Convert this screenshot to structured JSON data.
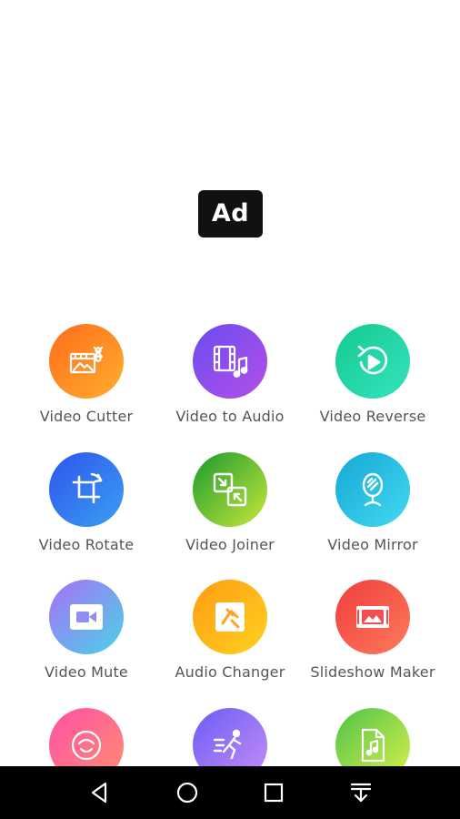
{
  "ad": {
    "badge_label": "Ad"
  },
  "tools": [
    {
      "label": "Video Cutter",
      "icon": "video-cutter-icon",
      "colors": [
        "#ff6a1a",
        "#ffb02e"
      ]
    },
    {
      "label": "Video to Audio",
      "icon": "video-to-audio-icon",
      "colors": [
        "#6a4cf0",
        "#b44fe8"
      ]
    },
    {
      "label": "Video Reverse",
      "icon": "reverse-icon",
      "colors": [
        "#16c98f",
        "#35e3c0"
      ]
    },
    {
      "label": "Video Rotate",
      "icon": "rotate-icon",
      "colors": [
        "#2f53ee",
        "#3aa0f2"
      ]
    },
    {
      "label": "Video Joiner",
      "icon": "joiner-icon",
      "colors": [
        "#1a9a2e",
        "#c8e83a"
      ]
    },
    {
      "label": "Video Mirror",
      "icon": "mirror-icon",
      "colors": [
        "#15a7d6",
        "#43d9f0"
      ]
    },
    {
      "label": "Video Mute",
      "icon": "mute-video-icon",
      "colors": [
        "#a870f5",
        "#49d3e8"
      ]
    },
    {
      "label": "Audio Changer",
      "icon": "audio-changer-icon",
      "colors": [
        "#ff9b14",
        "#ffd21e"
      ]
    },
    {
      "label": "Slideshow Maker",
      "icon": "slideshow-icon",
      "colors": [
        "#ef3e3e",
        "#ff7a5a"
      ]
    },
    {
      "label": "",
      "icon": "gif-icon",
      "colors": [
        "#ff4fa5",
        "#ff8f72"
      ]
    },
    {
      "label": "",
      "icon": "running-man-icon",
      "colors": [
        "#6b5cf4",
        "#c58ef7"
      ]
    },
    {
      "label": "",
      "icon": "audio-file-icon",
      "colors": [
        "#4fc34a",
        "#d9f04a"
      ]
    }
  ],
  "nav": {
    "icons": [
      "back-triangle-icon",
      "home-circle-icon",
      "recents-square-icon",
      "notification-pull-icon"
    ],
    "bar_color": "#000000"
  }
}
